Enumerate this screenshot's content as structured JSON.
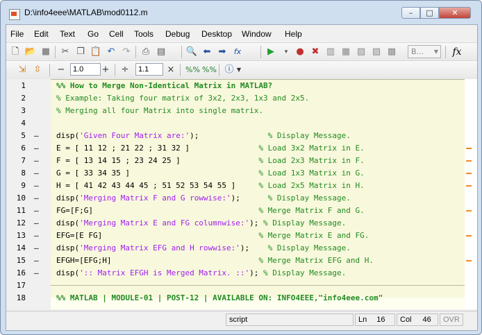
{
  "window": {
    "title": "D:\\info4eee\\MATLAB\\mod0112.m",
    "min": "–",
    "max": "□",
    "close": "✕"
  },
  "menu": [
    "File",
    "Edit",
    "Text",
    "Go",
    "Cell",
    "Tools",
    "Debug",
    "Desktop",
    "Window",
    "Help"
  ],
  "toolbar2": {
    "minus": "−",
    "value1": "1.0",
    "plus": "+",
    "divide": "÷",
    "value2": "1.1",
    "times": "×"
  },
  "toolbar1": {
    "stack_combo": "B..."
  },
  "lines": [
    {
      "n": "1",
      "dash": "",
      "code": [
        {
          "c": "cm b",
          "t": "%% How to Merge Non-Identical Matrix in MATLAB?"
        }
      ]
    },
    {
      "n": "2",
      "dash": "",
      "code": [
        {
          "c": "cm",
          "t": "% Example: Taking four matrix of 3x2, 2x3, 1x3 and 2x5."
        }
      ]
    },
    {
      "n": "3",
      "dash": "",
      "code": [
        {
          "c": "cm",
          "t": "% Merging all four Matrix into single matrix."
        }
      ]
    },
    {
      "n": "4",
      "dash": "",
      "code": []
    },
    {
      "n": "5",
      "dash": "–",
      "code": [
        {
          "c": "",
          "t": "disp("
        },
        {
          "c": "st",
          "t": "'Given Four Matrix are:'"
        },
        {
          "c": "",
          "t": ");               "
        },
        {
          "c": "cm",
          "t": "% Display Message."
        }
      ]
    },
    {
      "n": "6",
      "dash": "–",
      "code": [
        {
          "c": "",
          "t": "E = [ 11 12 ; 21 22 ; 31 32 ]               "
        },
        {
          "c": "cm",
          "t": "% Load 3x2 Matrix in E."
        }
      ]
    },
    {
      "n": "7",
      "dash": "–",
      "code": [
        {
          "c": "",
          "t": "F = [ 13 14 15 ; 23 24 25 ]                 "
        },
        {
          "c": "cm",
          "t": "% Load 2x3 Matrix in F."
        }
      ]
    },
    {
      "n": "8",
      "dash": "–",
      "code": [
        {
          "c": "",
          "t": "G = [ 33 34 35 ]                            "
        },
        {
          "c": "cm",
          "t": "% Load 1x3 Matrix in G."
        }
      ]
    },
    {
      "n": "9",
      "dash": "–",
      "code": [
        {
          "c": "",
          "t": "H = [ 41 42 43 44 45 ; 51 52 53 54 55 ]     "
        },
        {
          "c": "cm",
          "t": "% Load 2x5 Matrix in H."
        }
      ]
    },
    {
      "n": "10",
      "dash": "–",
      "code": [
        {
          "c": "",
          "t": "disp("
        },
        {
          "c": "st",
          "t": "'Merging Matrix F and G rowwise:'"
        },
        {
          "c": "",
          "t": ");      "
        },
        {
          "c": "cm",
          "t": "% Display Message."
        }
      ]
    },
    {
      "n": "11",
      "dash": "–",
      "code": [
        {
          "c": "",
          "t": "FG=[F;G]                                    "
        },
        {
          "c": "cm",
          "t": "% Merge Matrix F and G."
        }
      ]
    },
    {
      "n": "12",
      "dash": "–",
      "code": [
        {
          "c": "",
          "t": "disp("
        },
        {
          "c": "st",
          "t": "'Merging Matrix E and FG columnwise:'"
        },
        {
          "c": "",
          "t": "); "
        },
        {
          "c": "cm",
          "t": "% Display Message."
        }
      ]
    },
    {
      "n": "13",
      "dash": "–",
      "code": [
        {
          "c": "",
          "t": "EFG=[E FG]                                  "
        },
        {
          "c": "cm",
          "t": "% Merge Matrix E and FG."
        }
      ]
    },
    {
      "n": "14",
      "dash": "–",
      "code": [
        {
          "c": "",
          "t": "disp("
        },
        {
          "c": "st",
          "t": "'Merging Matrix EFG and H rowwise:'"
        },
        {
          "c": "",
          "t": ");    "
        },
        {
          "c": "cm",
          "t": "% Display Message."
        }
      ]
    },
    {
      "n": "15",
      "dash": "–",
      "code": [
        {
          "c": "",
          "t": "EFGH=[EFG;H]                                "
        },
        {
          "c": "cm",
          "t": "% Merge Matrix EFG and H."
        }
      ]
    },
    {
      "n": "16",
      "dash": "–",
      "code": [
        {
          "c": "",
          "t": "disp("
        },
        {
          "c": "st",
          "t": "':: Matrix EFGH is Merged Matrix. ::'"
        },
        {
          "c": "",
          "t": "); "
        },
        {
          "c": "cm",
          "t": "% Display Message."
        }
      ]
    },
    {
      "n": "17",
      "dash": "",
      "code": []
    },
    {
      "n": "18",
      "dash": "",
      "code": [
        {
          "c": "cm b",
          "t": "%% MATLAB | MODULE-01 | POST-12 | AVAILABLE ON: INFO4EEE,\"info4eee.com\""
        }
      ]
    }
  ],
  "status": {
    "mode": "script",
    "ln_label": "Ln",
    "ln": "16",
    "col_label": "Col",
    "col": "46",
    "ovr": "OVR"
  },
  "colors": {
    "comment": "#228B22",
    "string": "#A020F0",
    "cell_bg": "#f8f8dc",
    "warning_mark": "#f08a24"
  }
}
